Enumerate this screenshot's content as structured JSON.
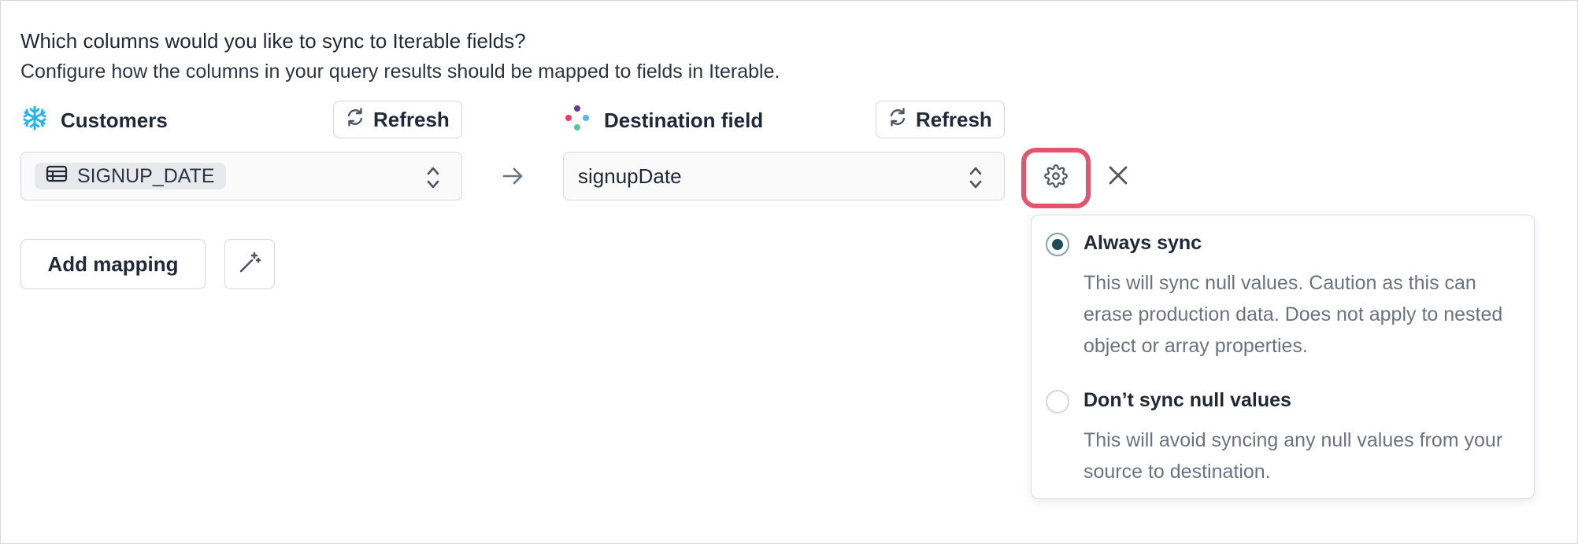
{
  "question": {
    "title": "Which columns would you like to sync to Iterable fields?",
    "subtitle": "Configure how the columns in your query results should be mapped to fields in Iterable."
  },
  "source": {
    "header_label": "Customers",
    "icon": "snowflake-icon",
    "refresh_label": "Refresh",
    "selected_column": "SIGNUP_DATE"
  },
  "destination": {
    "header_label": "Destination field",
    "icon": "iterable-logo-icon",
    "refresh_label": "Refresh",
    "selected_field": "signupDate"
  },
  "actions": {
    "add_mapping_label": "Add mapping"
  },
  "sync_options": {
    "selected": "always_sync",
    "options": [
      {
        "id": "always_sync",
        "title": "Always sync",
        "description": "This will sync null values. Caution as this can erase production data. Does not apply to nested object or array properties."
      },
      {
        "id": "dont_sync_null",
        "title": "Don’t sync null values",
        "description": "This will avoid syncing any null values from your source to destination."
      }
    ]
  },
  "colors": {
    "highlight_border": "#e2566c",
    "radio_selected": "#1e4e55",
    "snowflake": "#29b5e8"
  }
}
